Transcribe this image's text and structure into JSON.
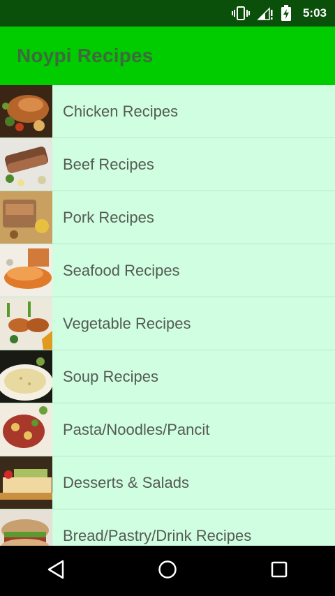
{
  "status_bar": {
    "time": "5:03",
    "icons": [
      "vibrate-icon",
      "signal-icon",
      "battery-charging-icon"
    ]
  },
  "app_bar": {
    "title": "Noypi Recipes"
  },
  "categories": [
    {
      "label": "Chicken Recipes",
      "thumb_icon": "chicken-dish-thumbnail"
    },
    {
      "label": "Beef Recipes",
      "thumb_icon": "beef-dish-thumbnail"
    },
    {
      "label": "Pork Recipes",
      "thumb_icon": "pork-dish-thumbnail"
    },
    {
      "label": "Seafood Recipes",
      "thumb_icon": "seafood-dish-thumbnail"
    },
    {
      "label": "Vegetable Recipes",
      "thumb_icon": "vegetable-dish-thumbnail"
    },
    {
      "label": "Soup Recipes",
      "thumb_icon": "soup-dish-thumbnail"
    },
    {
      "label": "Pasta/Noodles/Pancit",
      "thumb_icon": "pasta-dish-thumbnail"
    },
    {
      "label": "Desserts & Salads",
      "thumb_icon": "dessert-dish-thumbnail"
    },
    {
      "label": "Bread/Pastry/Drink Recipes",
      "thumb_icon": "bread-dish-thumbnail"
    }
  ],
  "nav_bar": {
    "icons": [
      "back-icon",
      "home-icon",
      "recents-icon"
    ]
  },
  "colors": {
    "status_bar": "#0a4f0a",
    "app_bar": "#00cc00",
    "list_background": "#cfffe0",
    "title_text": "#3e6b3e",
    "row_text": "#555a55"
  }
}
